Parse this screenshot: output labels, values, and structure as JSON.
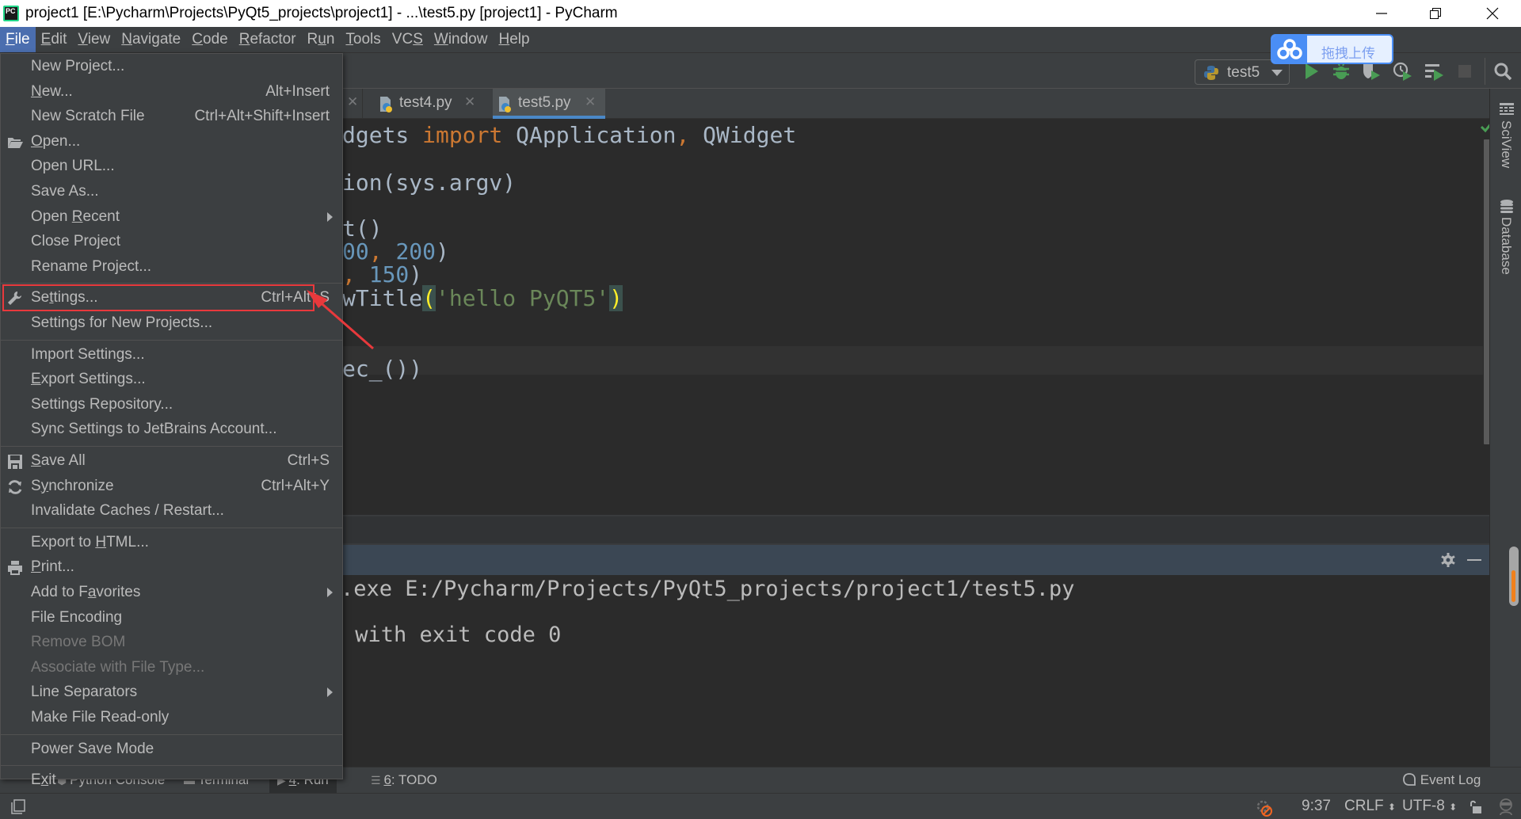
{
  "window": {
    "title": "project1 [E:\\Pycharm\\Projects\\PyQt5_projects\\project1] - ...\\test5.py [project1] - PyCharm",
    "app_icon": "PC",
    "controls": [
      "minimize",
      "restore",
      "close"
    ]
  },
  "menubar": {
    "items": [
      {
        "label": "File",
        "mnemonic": "F",
        "active": true
      },
      {
        "label": "Edit",
        "mnemonic": "E"
      },
      {
        "label": "View",
        "mnemonic": "V"
      },
      {
        "label": "Navigate",
        "mnemonic": "N"
      },
      {
        "label": "Code",
        "mnemonic": "C"
      },
      {
        "label": "Refactor",
        "mnemonic": "R"
      },
      {
        "label": "Run",
        "mnemonic": "u"
      },
      {
        "label": "Tools",
        "mnemonic": "T"
      },
      {
        "label": "VCS",
        "mnemonic": "S"
      },
      {
        "label": "Window",
        "mnemonic": "W"
      },
      {
        "label": "Help",
        "mnemonic": "H"
      }
    ]
  },
  "upload_widget": {
    "label": "拖拽上传"
  },
  "toolbar": {
    "run_config": "test5",
    "icons": [
      "run-icon",
      "debug-icon",
      "coverage-icon",
      "profile-icon",
      "concurrency-icon",
      "stop-icon",
      "search-icon"
    ]
  },
  "tabs": [
    {
      "name": "test4.py",
      "active": false
    },
    {
      "name": "test5.py",
      "active": true
    }
  ],
  "editor": {
    "lines": [
      {
        "text_parts": [
          [
            "plain",
            "dgets "
          ],
          [
            "kw",
            "import"
          ],
          [
            "plain",
            " QApplication"
          ],
          [
            "kw",
            ","
          ],
          [
            "plain",
            " QWidget"
          ]
        ]
      },
      {
        "text_parts": [
          [
            "plain",
            "ion(sys.argv)"
          ]
        ]
      },
      {
        "text_parts": [
          [
            "plain",
            "t()"
          ]
        ]
      },
      {
        "text_parts": [
          [
            "num",
            "00"
          ],
          [
            "kw",
            ","
          ],
          [
            "plain",
            " "
          ],
          [
            "num",
            "200"
          ],
          [
            "plain",
            ")"
          ]
        ]
      },
      {
        "text_parts": [
          [
            "kw",
            ","
          ],
          [
            "plain",
            " "
          ],
          [
            "num",
            "150"
          ],
          [
            "plain",
            ")"
          ]
        ]
      },
      {
        "text_parts": [
          [
            "plain",
            "wTitle"
          ],
          [
            "hl",
            "("
          ],
          [
            "str",
            "'hello PyQT5'"
          ],
          [
            "hl",
            ")"
          ]
        ]
      },
      {
        "text_parts": [
          [
            "plain",
            "ec_())"
          ]
        ]
      }
    ]
  },
  "right_strip": {
    "sciview": "SciView",
    "database": "Database"
  },
  "run_panel": {
    "output": [
      ".exe E:/Pycharm/Projects/PyQt5_projects/project1/test5.py",
      "",
      " with exit code 0"
    ]
  },
  "tool_tabs": [
    {
      "label": "Python Console"
    },
    {
      "label": "Terminal"
    },
    {
      "label": "4. Run",
      "mnemonic": "4",
      "active": true
    },
    {
      "label": "6: TODO",
      "mnemonic": "6"
    }
  ],
  "event_log": "Event Log",
  "statusbar": {
    "position": "9:37",
    "line_sep": "CRLF",
    "encoding": "UTF-8"
  },
  "file_menu": {
    "groups": [
      [
        {
          "label": "New Project...",
          "shortcut": ""
        },
        {
          "label": "New...",
          "mnemonic_index": 0,
          "shortcut": "Alt+Insert"
        },
        {
          "label": "New Scratch File",
          "shortcut": "Ctrl+Alt+Shift+Insert"
        },
        {
          "label": "Open...",
          "mnemonic_index": 0,
          "icon": "folder-open-icon",
          "shortcut": ""
        },
        {
          "label": "Open URL...",
          "shortcut": ""
        },
        {
          "label": "Save As...",
          "shortcut": ""
        },
        {
          "label": "Open Recent",
          "mnemonic_index": 5,
          "submenu": true
        },
        {
          "label": "Close Project",
          "shortcut": ""
        },
        {
          "label": "Rename Project...",
          "shortcut": ""
        }
      ],
      [
        {
          "label": "Settings...",
          "mnemonic_index": 2,
          "icon": "wrench-icon",
          "shortcut": "Ctrl+Alt+S",
          "highlighted": true
        },
        {
          "label": "Settings for New Projects...",
          "shortcut": ""
        }
      ],
      [
        {
          "label": "Import Settings...",
          "shortcut": ""
        },
        {
          "label": "Export Settings...",
          "mnemonic_index": 0,
          "shortcut": ""
        },
        {
          "label": "Settings Repository...",
          "shortcut": ""
        },
        {
          "label": "Sync Settings to JetBrains Account...",
          "shortcut": ""
        }
      ],
      [
        {
          "label": "Save All",
          "mnemonic_index": 0,
          "icon": "save-icon",
          "shortcut": "Ctrl+S"
        },
        {
          "label": "Synchronize",
          "mnemonic_index": 1,
          "icon": "sync-icon",
          "shortcut": "Ctrl+Alt+Y"
        },
        {
          "label": "Invalidate Caches / Restart...",
          "shortcut": ""
        }
      ],
      [
        {
          "label": "Export to HTML...",
          "mnemonic_index": 10,
          "shortcut": ""
        },
        {
          "label": "Print...",
          "mnemonic_index": 0,
          "icon": "print-icon",
          "shortcut": ""
        },
        {
          "label": "Add to Favorites",
          "mnemonic_index": 8,
          "submenu": true
        },
        {
          "label": "File Encoding",
          "shortcut": ""
        },
        {
          "label": "Remove BOM",
          "disabled": true
        },
        {
          "label": "Associate with File Type...",
          "disabled": true
        },
        {
          "label": "Line Separators",
          "submenu": true
        },
        {
          "label": "Make File Read-only",
          "shortcut": ""
        }
      ],
      [
        {
          "label": "Power Save Mode",
          "shortcut": ""
        }
      ],
      [
        {
          "label": "Exit",
          "mnemonic_index": 1,
          "shortcut": ""
        }
      ]
    ]
  },
  "colors": {
    "accent": "#4b6eaf",
    "annotation": "#e8393c",
    "run_green": "#499c54",
    "keyword": "#cc7832",
    "number": "#6897bb",
    "string": "#6a8759"
  }
}
